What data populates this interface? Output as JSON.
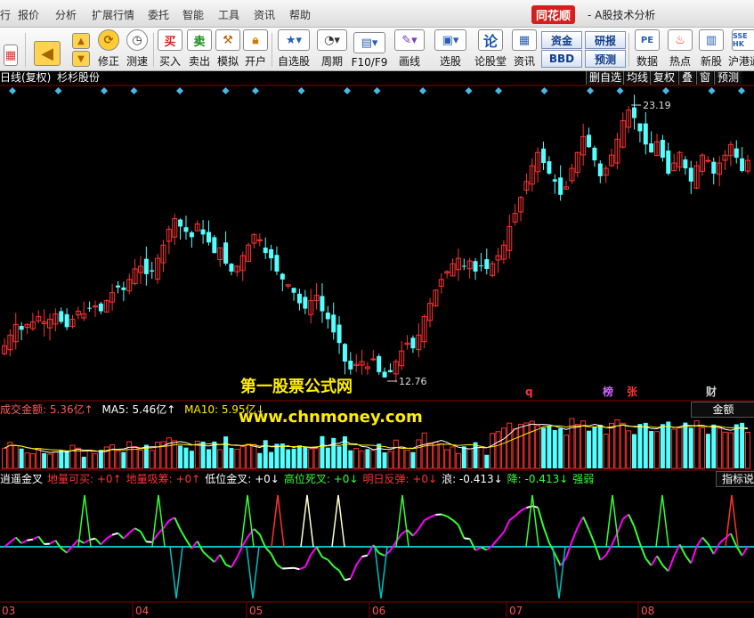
{
  "menu": [
    "行",
    "报价",
    "分析",
    "扩展行情",
    "委托",
    "智能",
    "工具",
    "资讯",
    "帮助"
  ],
  "brand": {
    "logo": "同花顺",
    "title": "- A股技术分析"
  },
  "toolbar": {
    "buttons": [
      "修正",
      "测速",
      "买入",
      "卖出",
      "模拟",
      "开户",
      "自选股",
      "周期",
      "F10/F9",
      "画线",
      "选股",
      "论股堂",
      "资讯",
      "数据",
      "热点",
      "新股",
      "沪港通"
    ],
    "icon_glyphs": {
      "buy": "买",
      "sell": "卖",
      "lungu": "论"
    },
    "pills": [
      "资金",
      "BBD",
      "研报",
      "预测"
    ]
  },
  "chart_header": {
    "period": "日线(复权)",
    "stock": "杉杉股份"
  },
  "chart_tabs": [
    "删自选",
    "均线",
    "复权",
    "叠",
    "窗",
    "预测"
  ],
  "annotations": {
    "high": "23.19",
    "low": "12.76"
  },
  "markers": [
    {
      "text": "q",
      "color": "#ff3333"
    },
    {
      "text": "榜",
      "color": "#cc66ff"
    },
    {
      "text": "张",
      "color": "#ff3333"
    },
    {
      "text": "财",
      "color": "#cccccc"
    }
  ],
  "watermark": {
    "name": "第一股票公式网",
    "url": "www.chnmoney.com"
  },
  "volume_panel": {
    "title": "成交金额: 5.36亿↑",
    "ma5": "MA5: 5.46亿↑",
    "ma10": "MA10: 5.95亿↓",
    "button": "金额"
  },
  "indicator_panel": {
    "parts": [
      {
        "text": "逍遥金叉",
        "color": "#ffffff"
      },
      {
        "text": "地量可买: +0↑",
        "color": "#ff3333"
      },
      {
        "text": "地量吸筹: +0↑",
        "color": "#ff3333"
      },
      {
        "text": "低位金叉: +0↓",
        "color": "#ffffff"
      },
      {
        "text": "高位死叉: +0↓",
        "color": "#33ff33"
      },
      {
        "text": "明日反弹: +0↓",
        "color": "#ff3333"
      },
      {
        "text": "浪: -0.413↓",
        "color": "#ffffff"
      },
      {
        "text": "降: -0.413↓",
        "color": "#33ff33"
      },
      {
        "text": "强弱",
        "color": "#33ff33"
      }
    ],
    "button": "指标说明"
  },
  "x_axis": [
    "03",
    "04",
    "05",
    "06",
    "07",
    "08"
  ],
  "colors": {
    "up": "#ff3232",
    "down": "#54ffff",
    "grid": "#8b0000",
    "indicator_white": "#ffffff",
    "indicator_magenta": "#ff00ff",
    "indicator_green": "#33ff33",
    "baseline": "#00c0c0"
  },
  "chart_data": {
    "type": "candlestick",
    "high": 23.19,
    "low": 12.76,
    "closes": [
      14.1,
      14.5,
      14.9,
      14.7,
      14.9,
      15.0,
      15.2,
      15.0,
      15.1,
      15.3,
      15.0,
      14.8,
      15.1,
      15.4,
      15.3,
      15.5,
      15.6,
      15.4,
      15.8,
      16.1,
      16.3,
      16.2,
      16.6,
      17.0,
      17.1,
      16.8,
      16.9,
      17.4,
      17.9,
      18.5,
      18.9,
      18.6,
      18.4,
      18.2,
      18.7,
      18.3,
      18.0,
      17.6,
      17.8,
      17.2,
      16.9,
      17.1,
      17.5,
      17.9,
      18.3,
      18.1,
      17.6,
      17.4,
      16.9,
      16.6,
      16.4,
      16.1,
      15.7,
      15.5,
      15.8,
      16.0,
      15.4,
      15.1,
      14.6,
      14.2,
      13.5,
      13.2,
      13.4,
      13.5,
      13.3,
      13.6,
      13.1,
      12.9,
      13.1,
      13.5,
      13.9,
      14.2,
      14.0,
      14.5,
      15.2,
      15.7,
      16.2,
      16.6,
      16.9,
      17.2,
      17.4,
      17.1,
      17.3,
      16.9,
      17.1,
      17.0,
      17.2,
      17.5,
      17.9,
      18.6,
      19.1,
      19.7,
      20.3,
      20.9,
      21.4,
      21.0,
      20.6,
      20.3,
      19.8,
      20.1,
      20.8,
      21.4,
      22.0,
      21.6,
      21.1,
      20.5,
      20.8,
      21.3,
      21.9,
      22.6,
      23.0,
      22.7,
      22.2,
      21.7,
      21.4,
      21.8,
      21.2,
      20.6,
      21.0,
      21.4,
      20.8,
      20.3,
      20.9,
      21.3,
      21.1,
      20.6,
      21.0,
      21.3,
      21.7,
      21.2,
      20.7,
      21.1
    ],
    "volume_unit": "亿",
    "volume_amount": 5.36,
    "volume_ma5": 5.46,
    "volume_ma10": 5.95,
    "indicator_value": -0.413
  }
}
